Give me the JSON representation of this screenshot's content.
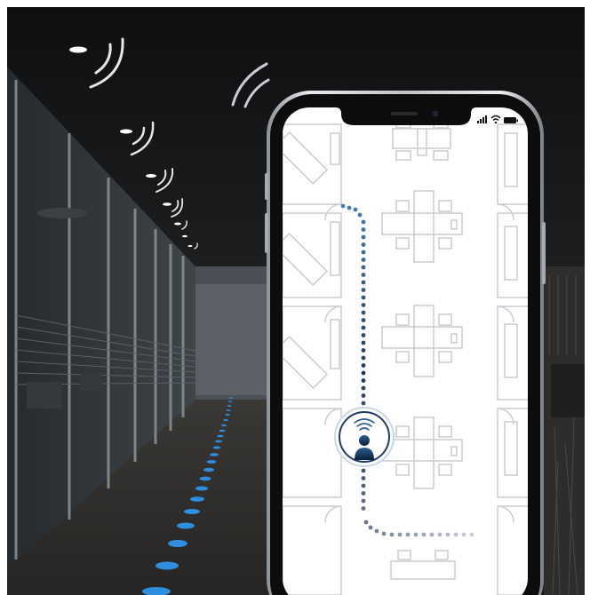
{
  "scene": {
    "description_icons": [
      "wifi-signal-icon",
      "user-location-icon",
      "signal-icon",
      "battery-icon"
    ],
    "colors": {
      "path_start": "#4a80b8",
      "path_mid": "#24364e",
      "path_end": "#c9ced6",
      "floor_dots": "#2e8fe0",
      "frame": "#c8ccd2",
      "ceiling": "#121314"
    }
  }
}
